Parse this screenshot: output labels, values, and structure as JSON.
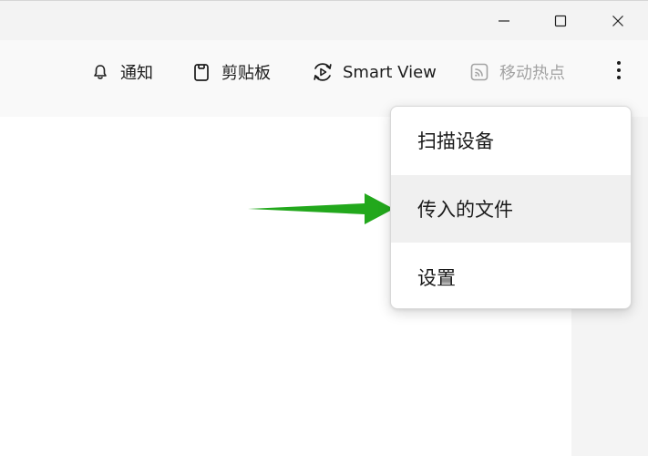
{
  "toolbar": {
    "notify_label": "通知",
    "clipboard_label": "剪贴板",
    "smartview_label": "Smart View",
    "hotspot_label": "移动热点"
  },
  "icons": {
    "notify": "bell-icon",
    "clipboard": "clipboard-icon",
    "smartview": "smart-view-icon",
    "hotspot": "hotspot-icon",
    "more": "more-vertical-icon",
    "minimize": "minimize-icon",
    "maximize": "maximize-icon",
    "close": "close-icon"
  },
  "menu": {
    "items": [
      {
        "label": "扫描设备"
      },
      {
        "label": "传入的文件"
      },
      {
        "label": "设置"
      }
    ]
  },
  "colors": {
    "arrow": "#22a81c",
    "menu_hover": "#f0f0f0",
    "disabled_text": "#a3a3a3"
  }
}
